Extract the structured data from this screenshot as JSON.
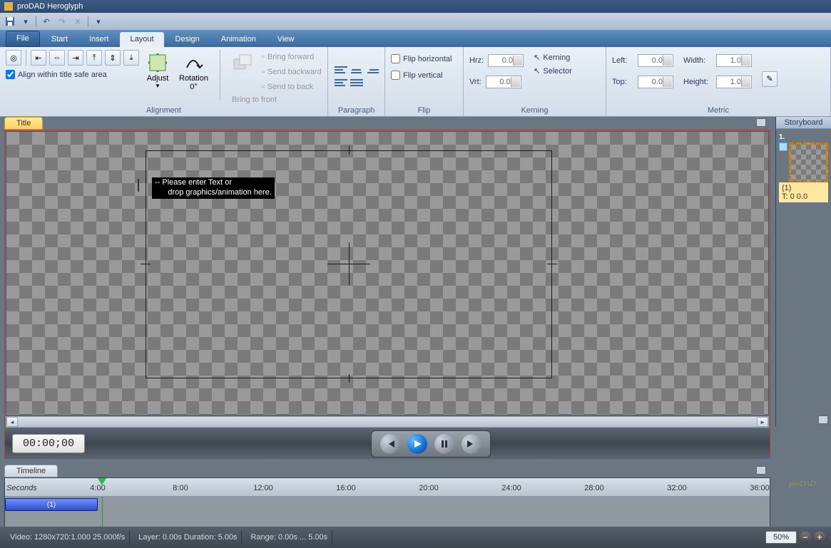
{
  "app": {
    "title": "proDAD Heroglyph"
  },
  "ribbon": {
    "tabs": {
      "file": "File",
      "start": "Start",
      "insert": "Insert",
      "layout": "Layout",
      "design": "Design",
      "animation": "Animation",
      "view": "View"
    },
    "active": "layout",
    "groups": {
      "alignment": {
        "label": "Alignment",
        "safe_area": "Align within title safe area",
        "adjust": "Adjust",
        "rotation": "Rotation",
        "rotation_val": "0°",
        "bring_front": "Bring to front",
        "bring_forward": "Bring forward",
        "send_backward": "Send backward",
        "send_back": "Send to back"
      },
      "paragraph": {
        "label": "Paragraph"
      },
      "flip": {
        "label": "Flip",
        "horizontal": "Flip horizontal",
        "vertical": "Flip vertical"
      },
      "kerning": {
        "label": "Kerning",
        "hrz": "Hrz:",
        "vrt": "Vrt:",
        "hrz_val": "0.0",
        "vrt_val": "0.0",
        "kerning_chk": "Kerning",
        "selector_chk": "Selector"
      },
      "metric": {
        "label": "Metric",
        "left": "Left:",
        "top": "Top:",
        "left_val": "0.0",
        "top_val": "0.0",
        "width": "Width:",
        "height": "Height:",
        "width_val": "1.0",
        "height_val": "1.0"
      }
    }
  },
  "panels": {
    "title": "Title",
    "timeline": "Timeline",
    "storyboard": "Storyboard"
  },
  "preview": {
    "placeholder_l1": "-- Please enter Text or",
    "placeholder_l2": "      drop graphics/animation here."
  },
  "transport": {
    "timecode": "00:00;00"
  },
  "timeline": {
    "unit": "Seconds",
    "ticks": [
      "4:00",
      "8:00",
      "12:00",
      "16:00",
      "20:00",
      "24:00",
      "28:00",
      "32:00",
      "36:00"
    ],
    "clip_label": "(1)"
  },
  "storyboard": {
    "item_num": "1.",
    "item_label": "(1)",
    "item_time": "T: 0  0.0"
  },
  "status": {
    "video": "Video: 1280x720:1.000  25.000f/s",
    "layer": "Layer: 0.00s  Duration: 5.00s",
    "range": "Range: 0.00s ... 5.00s",
    "zoom": "50%"
  }
}
